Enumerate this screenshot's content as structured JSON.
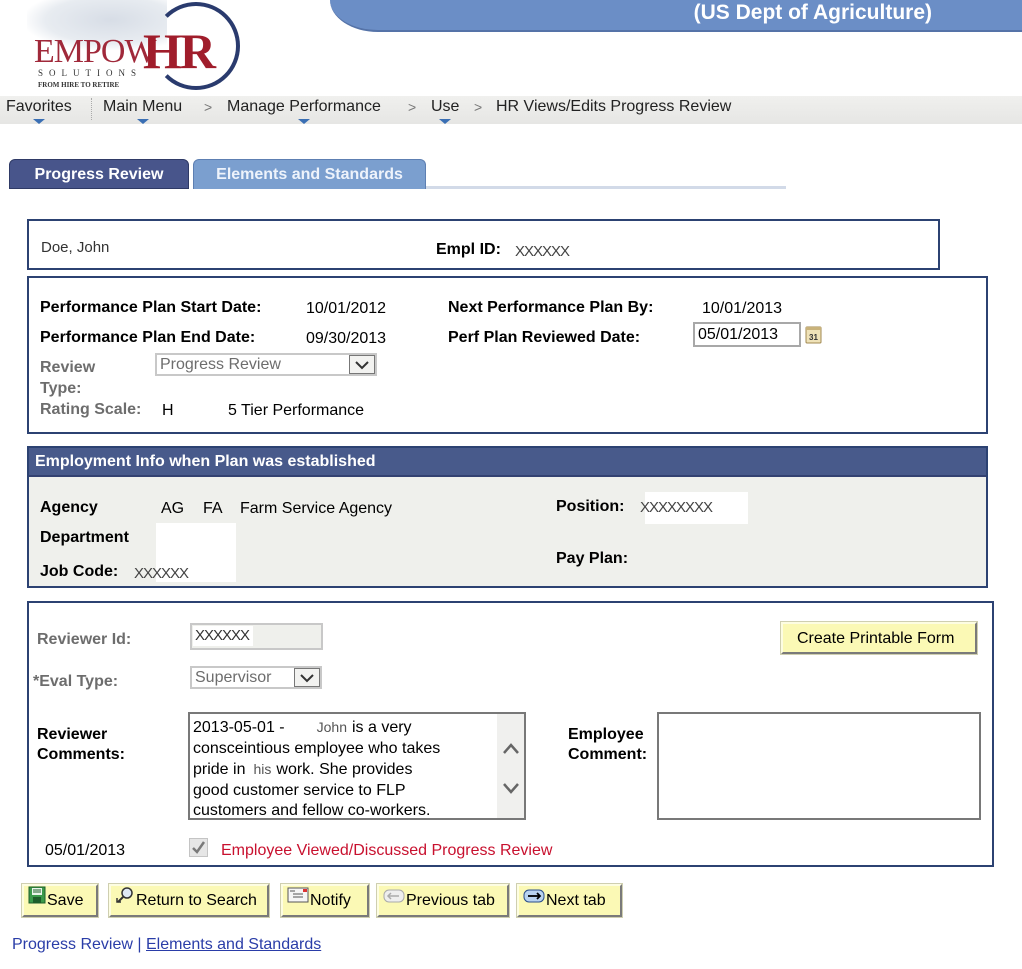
{
  "header": {
    "org_title": "(US Dept of Agriculture)",
    "logo": {
      "brand_part1": "EMPOW",
      "brand_part2": "HR",
      "sub": "SOLUTIONS",
      "tagline": "FROM HIRE TO RETIRE"
    }
  },
  "nav": {
    "favorites": "Favorites",
    "main_menu": "Main Menu",
    "manage_performance": "Manage Performance",
    "use": "Use",
    "current": "HR Views/Edits Progress Review",
    "separator": ">"
  },
  "tabs": [
    {
      "label": "Progress Review",
      "active": true
    },
    {
      "label": "Elements and Standards",
      "active": false
    }
  ],
  "employee": {
    "name": "Doe, John",
    "empl_id_label": "Empl ID:",
    "empl_id": "XXXXXX"
  },
  "plan": {
    "start_label": "Performance Plan Start Date:",
    "start_value": "10/01/2012",
    "end_label": "Performance Plan End Date:",
    "end_value": "09/30/2013",
    "next_label": "Next Performance Plan By:",
    "next_value": "10/01/2013",
    "reviewed_label": "Perf Plan Reviewed Date:",
    "reviewed_value": "05/01/2013",
    "review_type_label_1": "Review",
    "review_type_label_2": "Type:",
    "review_type_value": "Progress Review",
    "rating_scale_label": "Rating Scale:",
    "rating_scale_code": "H",
    "rating_scale_desc": "5 Tier Performance"
  },
  "employment_info": {
    "title": "Employment Info when Plan was established",
    "agency_label": "Agency",
    "agency_code1": "AG",
    "agency_code2": "FA",
    "agency_name": "Farm Service Agency",
    "department_label": "Department",
    "job_code_label": "Job Code:",
    "job_code_value": "XXXXXX",
    "position_label": "Position:",
    "position_value": "XXXXXXXX",
    "pay_plan_label": "Pay Plan:"
  },
  "review": {
    "reviewer_id_label": "Reviewer Id:",
    "reviewer_id_value": "XXXXXX",
    "eval_type_label": "*Eval Type:",
    "eval_type_value": "Supervisor",
    "create_form_button": "Create Printable Form",
    "reviewer_comments_label_1": "Reviewer",
    "reviewer_comments_label_2": "Comments:",
    "reviewer_comments_lines": [
      {
        "a": "2013-05-01 -",
        "b": "John",
        "c": "is a  very"
      },
      {
        "a": "consceintious employee who takes"
      },
      {
        "a": "pride in",
        "b": "his",
        "c": "work.  She provides"
      },
      {
        "a": "good customer service to FLP"
      },
      {
        "a": "customers and fellow co-workers."
      }
    ],
    "employee_comment_label_1": "Employee",
    "employee_comment_label_2": "Comment:",
    "employee_comment_value": "",
    "viewed_date": "05/01/2013",
    "viewed_checked": true,
    "viewed_label": "Employee Viewed/Discussed Progress Review",
    "viewed_label_color": "#c8102e"
  },
  "toolbar": {
    "save": "Save",
    "return_to_search": "Return to Search",
    "notify": "Notify",
    "previous_tab": "Previous tab",
    "next_tab": "Next tab"
  },
  "footer": {
    "current_page": "Progress Review",
    "separator": "|",
    "other_page": "Elements and Standards"
  }
}
